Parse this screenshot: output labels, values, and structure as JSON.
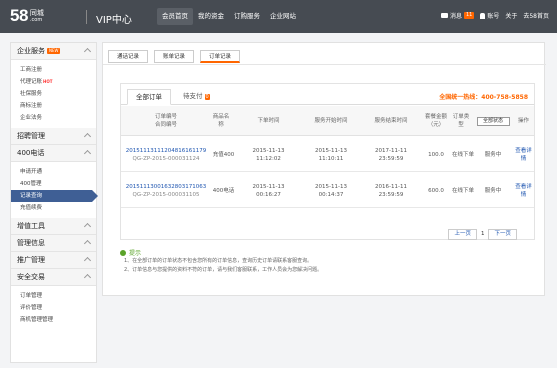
{
  "header": {
    "logo_number": "58",
    "logo_cn": "同城",
    "logo_com": ".com",
    "title": "VIP中心",
    "nav": [
      "会员首页",
      "我的资金",
      "订购服务",
      "企业网站"
    ],
    "messages_label": "消息",
    "messages_count": "11",
    "user_label": "账号",
    "help_label": "关于",
    "back_label": "去58首页"
  },
  "sidebar": {
    "sections": [
      {
        "title": "企业服务",
        "tag": "NEW",
        "items": [
          "工商注册",
          "代理记账",
          "社保服务",
          "商标注册",
          "企业法务"
        ]
      },
      {
        "title": "招聘管理",
        "items": []
      },
      {
        "title": "400电话",
        "items": [
          "申请开通",
          "400管理",
          "记录查询",
          "充值续费"
        ]
      },
      {
        "title": "增值工具",
        "items": []
      },
      {
        "title": "管理信息",
        "items": []
      },
      {
        "title": "推广管理",
        "items": []
      },
      {
        "title": "安全交易",
        "items": [
          "订单管理",
          "评价管理",
          "商机管理管理"
        ]
      }
    ],
    "hot_tag": "HOT"
  },
  "main": {
    "tabs": [
      "通话记录",
      "账单记录",
      "订单记录"
    ],
    "sub_tabs": {
      "all": "全部订单",
      "pending": "待支付",
      "pending_count": "0"
    },
    "hotline": "全国统一热线：400-758-5858",
    "columns": {
      "order_no": "订单编号\n合同编号",
      "product": "商品名称",
      "order_time": "下单时间",
      "service_start": "服务开始时间",
      "service_end": "服务结束时间",
      "amount": "套餐金额\n（元）",
      "order_type": "订单类型",
      "type_select": "全部状态",
      "status": "",
      "action": "操作"
    },
    "rows": [
      {
        "order_no": "20151113111204816161179",
        "contract_no": "QG-ZP-2015-000031124",
        "product": "充值400",
        "order_time": "2015-11-13\n11:12:02",
        "service_start": "2015-11-13\n11:10:11",
        "service_end": "2017-11-11\n23:59:59",
        "amount": "100.0",
        "order_type": "在线下单",
        "status": "服务中",
        "action": "查看详情"
      },
      {
        "order_no": "20151113001632803171063",
        "contract_no": "QG-ZP-2015-000031105",
        "product": "400电话",
        "order_time": "2015-11-13\n00:16:27",
        "service_start": "2015-11-13\n00:14:37",
        "service_end": "2016-11-11\n23:59:59",
        "amount": "600.0",
        "order_type": "在线下单",
        "status": "服务中",
        "action": "查看详情"
      }
    ],
    "pager": {
      "prev": "上一页",
      "page": "1",
      "next": "下一页"
    },
    "tips": {
      "title": "提示",
      "lines": [
        "1、在全部订单的订单状态不包含您所有的订单信息，查询历史订单请联系客服查询。",
        "2、订单信息与您提供的资料不符的订单，请与我们客服联系，工作人员会为您解决问题。"
      ]
    }
  },
  "colors": {
    "topbar": "#464b52",
    "accent": "#f60",
    "active_side": "#3f5f95",
    "link": "#1e55b0",
    "tip": "#5aa329"
  }
}
